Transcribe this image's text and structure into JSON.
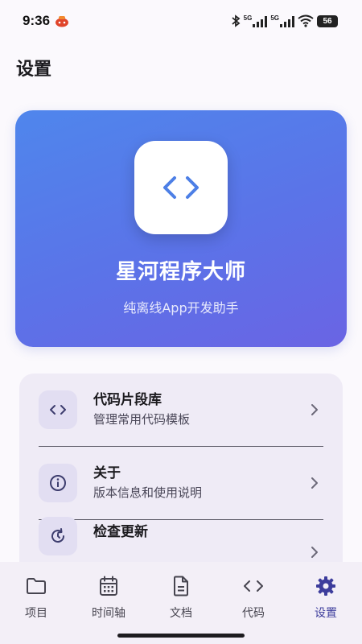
{
  "status_bar": {
    "time": "9:36",
    "network_left": "5G",
    "network_right": "5G",
    "battery": "56"
  },
  "page": {
    "title": "设置"
  },
  "hero": {
    "app_name": "星河程序大师",
    "tagline": "纯离线App开发助手",
    "logo_icon": "code-brackets-icon",
    "gradient_start": "#4f86ec",
    "gradient_end": "#6a64e4"
  },
  "menu": {
    "items": [
      {
        "title": "代码片段库",
        "subtitle": "管理常用代码模板",
        "icon": "code-icon"
      },
      {
        "title": "关于",
        "subtitle": "版本信息和使用说明",
        "icon": "info-icon"
      },
      {
        "title": "检查更新",
        "subtitle": "",
        "icon": "refresh-icon"
      }
    ]
  },
  "bottom_nav": {
    "items": [
      {
        "label": "项目",
        "icon": "folder-icon"
      },
      {
        "label": "时间轴",
        "icon": "calendar-icon"
      },
      {
        "label": "文档",
        "icon": "document-icon"
      },
      {
        "label": "代码",
        "icon": "code-icon"
      },
      {
        "label": "设置",
        "icon": "gear-icon"
      }
    ],
    "active": "设置",
    "active_color": "#3d3d9c"
  }
}
